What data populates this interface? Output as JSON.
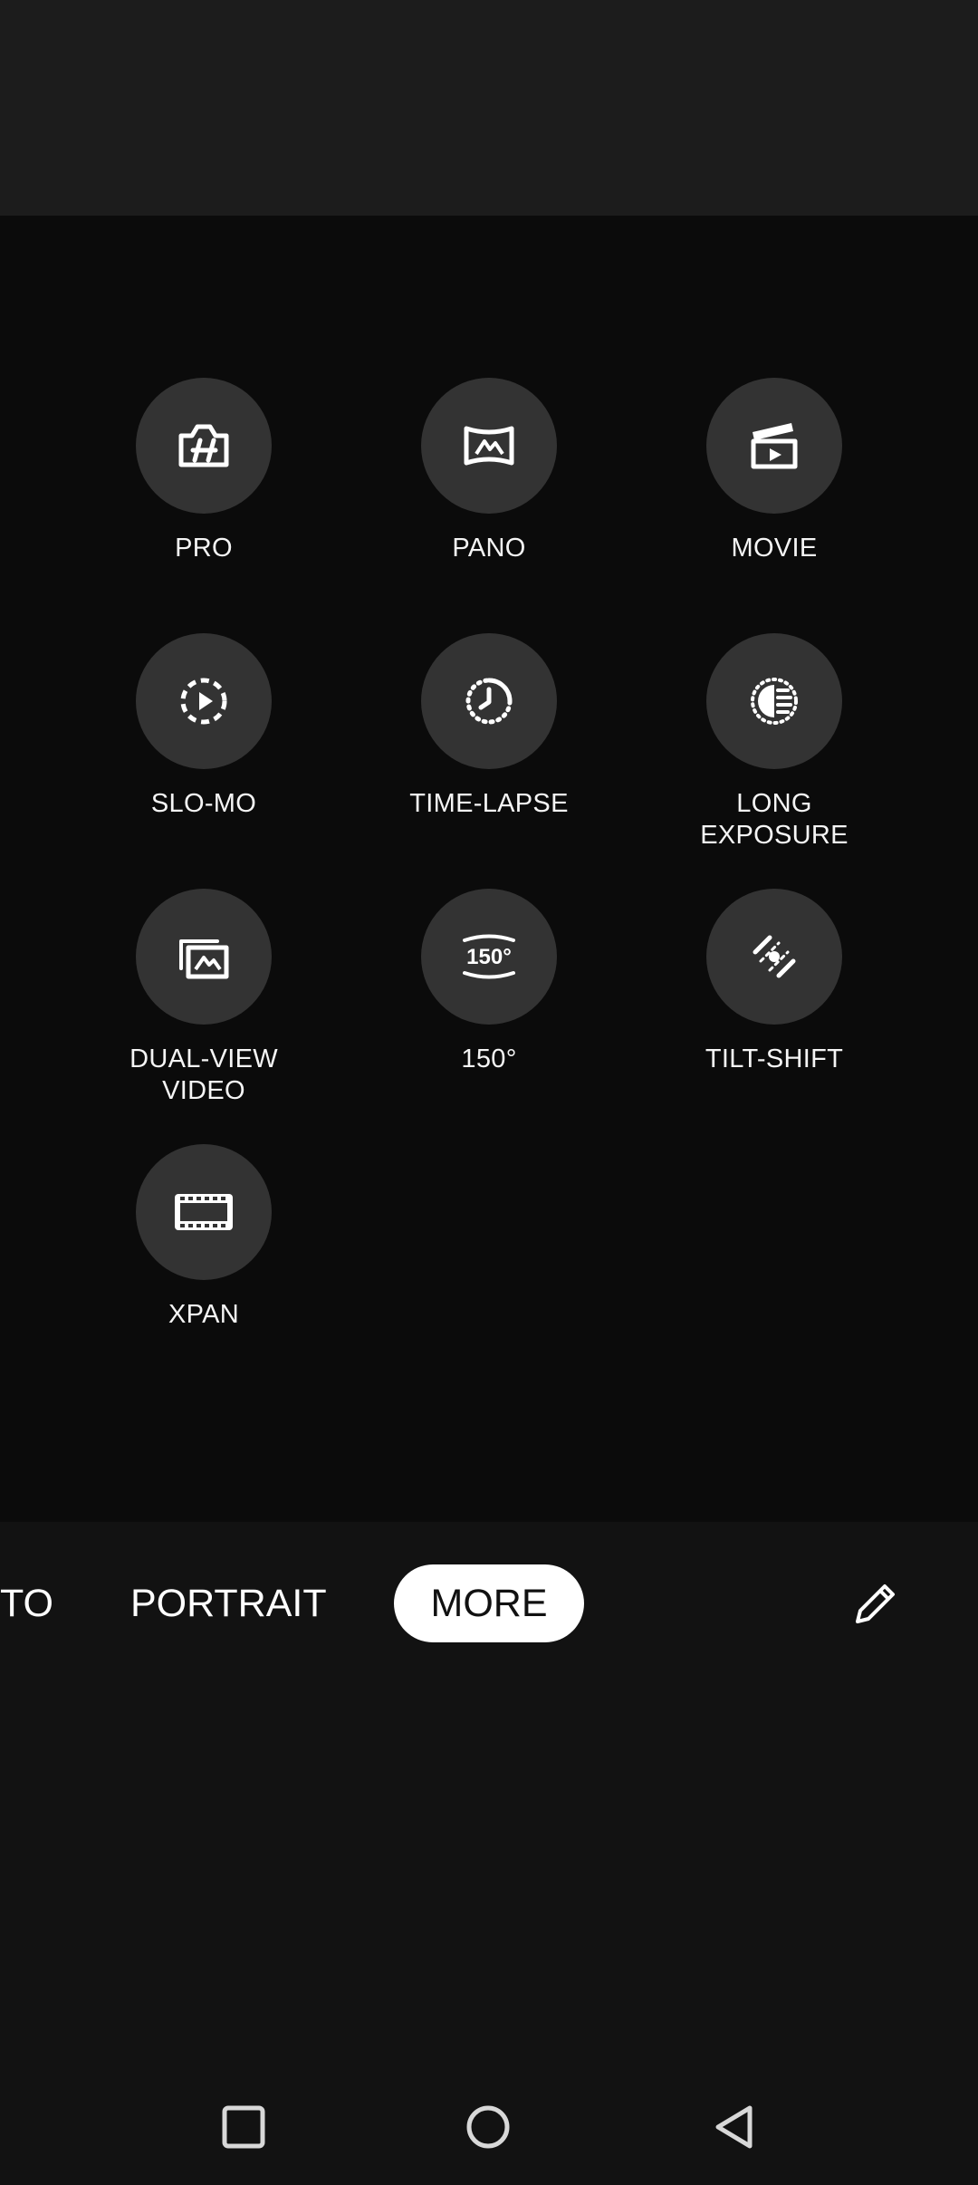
{
  "modes": [
    {
      "label": "PRO",
      "icon": "hasselblad-camera-icon"
    },
    {
      "label": "PANO",
      "icon": "panorama-icon"
    },
    {
      "label": "MOVIE",
      "icon": "clapperboard-icon"
    },
    {
      "label": "SLO-MO",
      "icon": "slow-motion-icon"
    },
    {
      "label": "TIME-LAPSE",
      "icon": "timelapse-icon"
    },
    {
      "label": "LONG\nEXPOSURE",
      "icon": "long-exposure-icon"
    },
    {
      "label": "DUAL-VIEW\nVIDEO",
      "icon": "dual-view-icon"
    },
    {
      "label": "150°",
      "icon": "wide-angle-150-icon",
      "icon_text": "150°"
    },
    {
      "label": "TILT-SHIFT",
      "icon": "tilt-shift-icon"
    },
    {
      "label": "XPAN",
      "icon": "xpan-film-icon"
    }
  ],
  "mode_strip": {
    "photo_partial": "TO",
    "portrait": "PORTRAIT",
    "more": "MORE",
    "edit_icon": "pencil-icon"
  },
  "nav": {
    "recents_icon": "square-icon",
    "home_icon": "circle-icon",
    "back_icon": "triangle-back-icon"
  },
  "colors": {
    "background": "#121212",
    "panel": "#0b0b0b",
    "mode_circle": "#333333",
    "selected_pill": "#ffffff"
  }
}
